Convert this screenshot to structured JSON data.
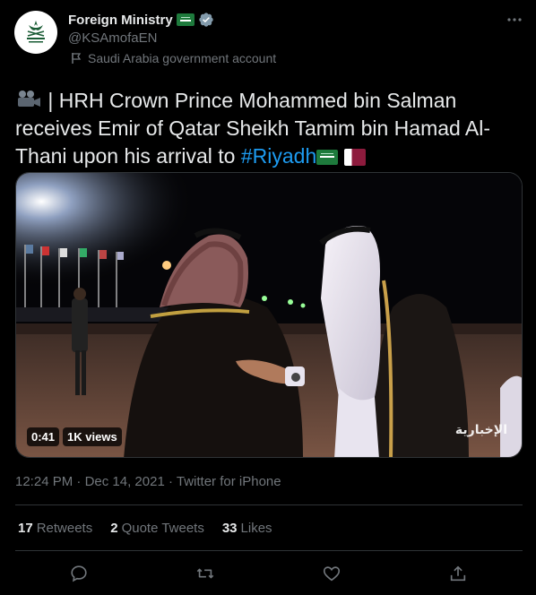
{
  "author": {
    "display_name": "Foreign Ministry",
    "handle": "@KSAmofaEN",
    "account_label": "Saudi Arabia government account",
    "verified_icon": "verified-badge-icon",
    "flag_icon": "saudi-flag-emoji"
  },
  "tweet": {
    "text_prefix": "| HRH Crown Prince Mohammed bin Salman receives Emir of Qatar Sheikh Tamim bin Hamad Al-Thani upon his arrival to ",
    "hashtag": "#Riyadh",
    "leading_icon": "video-camera-emoji",
    "trailing_icons": [
      "saudi-flag-emoji",
      "qatar-flag-emoji"
    ]
  },
  "media": {
    "duration": "0:41",
    "views": "1K views",
    "watermark": "الإخبارية"
  },
  "meta": {
    "time": "12:24 PM",
    "separator": "·",
    "date": "Dec 14, 2021",
    "source": "Twitter for iPhone"
  },
  "stats": {
    "retweets_count": "17",
    "retweets_label": "Retweets",
    "quotes_count": "2",
    "quotes_label": "Quote Tweets",
    "likes_count": "33",
    "likes_label": "Likes"
  },
  "colors": {
    "background": "#000000",
    "text_primary": "#e7e9ea",
    "text_secondary": "#71767b",
    "link": "#1d9bf0",
    "divider": "#2f3336"
  }
}
